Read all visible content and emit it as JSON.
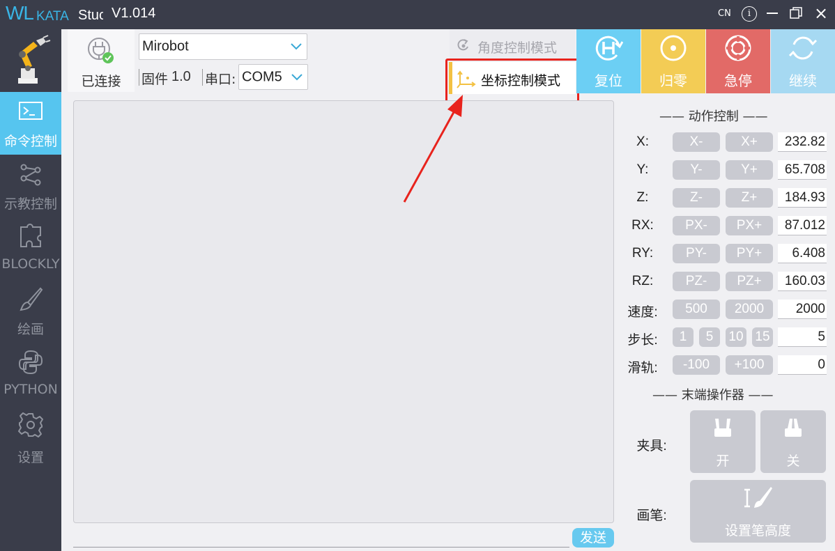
{
  "titlebar": {
    "logo_wl": "WL",
    "logo_kata": "KATA",
    "logo_stu": "Stuc",
    "version": "V1.014",
    "lang": "CN",
    "info_glyph": "i",
    "close_glyph": "×"
  },
  "sidebar": {
    "items": [
      {
        "label": "命令控制",
        "icon": "terminal-icon",
        "active": true
      },
      {
        "label": "示教控制",
        "icon": "path-nodes-icon",
        "active": false
      },
      {
        "label": "BLOCKLY",
        "icon": "puzzle-icon",
        "active": false
      },
      {
        "label": "绘画",
        "icon": "brush-icon",
        "active": false
      },
      {
        "label": "PYTHON",
        "icon": "python-icon",
        "active": false
      },
      {
        "label": "设置",
        "icon": "gear-icon",
        "active": false
      }
    ]
  },
  "connection": {
    "status_label": "已连接",
    "robot_model": "Mirobot",
    "firmware_label": "固件",
    "firmware_version": "1.0",
    "port_label": "串口:",
    "port_value": "COM5"
  },
  "modes": {
    "angle_mode": "角度控制模式",
    "coord_mode": "坐标控制模式"
  },
  "actions": {
    "reset": "复位",
    "home": "归零",
    "estop": "急停",
    "resume": "继续"
  },
  "colors": {
    "reset": "#6ccff4",
    "home": "#f3cc55",
    "estop": "#e26a67",
    "resume": "#a6d9f2",
    "active_sidebar": "#56c5ef",
    "highlight": "#e8231d"
  },
  "send_label": "发送",
  "motion": {
    "title": "—— 动作控制 ——",
    "rows": [
      {
        "label": "X:",
        "minus": "X-",
        "plus": "X+",
        "value": "232.82"
      },
      {
        "label": "Y:",
        "minus": "Y-",
        "plus": "Y+",
        "value": "65.708"
      },
      {
        "label": "Z:",
        "minus": "Z-",
        "plus": "Z+",
        "value": "184.93"
      },
      {
        "label": "RX:",
        "minus": "PX-",
        "plus": "PX+",
        "value": "87.012"
      },
      {
        "label": "RY:",
        "minus": "PY-",
        "plus": "PY+",
        "value": "6.408"
      },
      {
        "label": "RZ:",
        "minus": "PZ-",
        "plus": "PZ+",
        "value": "160.03"
      }
    ],
    "speed": {
      "label": "速度:",
      "opt1": "500",
      "opt2": "2000",
      "value": "2000"
    },
    "step": {
      "label": "步长:",
      "opts": [
        "1",
        "5",
        "10",
        "15"
      ],
      "value": "5"
    },
    "rail": {
      "label": "滑轨:",
      "minus": "-100",
      "plus": "+100",
      "value": "0"
    }
  },
  "effector": {
    "title": "—— 末端操作器 ——",
    "gripper_label": "夹具:",
    "open": "开",
    "close": "关",
    "pen_label": "画笔:",
    "pen_height": "设置笔高度"
  }
}
